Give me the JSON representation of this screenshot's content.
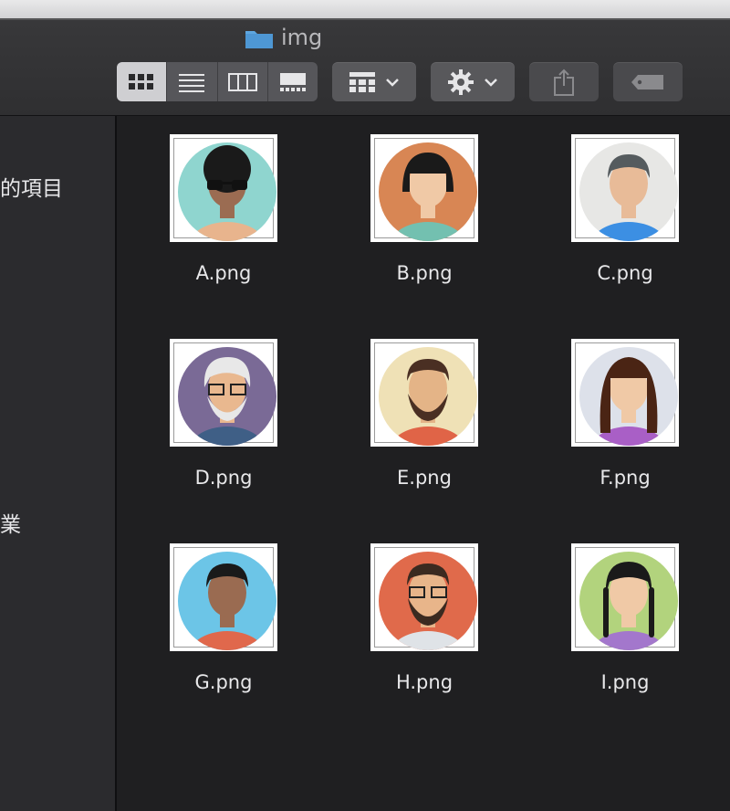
{
  "window": {
    "title": "img"
  },
  "toolbar": {
    "view_modes": [
      "icon-view",
      "list-view",
      "column-view",
      "gallery-view"
    ],
    "active_view": "icon-view",
    "group_button": "group-by",
    "action_button": "gear",
    "share_button": "share",
    "tag_button": "tag"
  },
  "sidebar": {
    "items": [
      {
        "label": "的項目"
      },
      {
        "label": "業"
      }
    ]
  },
  "files": [
    {
      "name": "A.png",
      "bg": "#8fd5cf",
      "skin": "#9b6c52",
      "hair": "#1a1a1a",
      "shirt": "#e8b48d",
      "style": "afro-glasses"
    },
    {
      "name": "B.png",
      "bg": "#d88654",
      "skin": "#f0c9a6",
      "hair": "#1a1a1a",
      "shirt": "#73c0b0",
      "style": "bob"
    },
    {
      "name": "C.png",
      "bg": "#e7e7e5",
      "skin": "#e8bb98",
      "hair": "#555b5e",
      "shirt": "#3c8fe3",
      "style": "short"
    },
    {
      "name": "D.png",
      "bg": "#7a6a96",
      "skin": "#e9b88f",
      "hair": "#e8e8e8",
      "shirt": "#3f5f86",
      "style": "old-beard"
    },
    {
      "name": "E.png",
      "bg": "#efe1b6",
      "skin": "#e4b487",
      "hair": "#4a2f23",
      "shirt": "#e06447",
      "style": "beard"
    },
    {
      "name": "F.png",
      "bg": "#dde1ea",
      "skin": "#f0c9a6",
      "hair": "#4a2414",
      "shirt": "#a95fc6",
      "style": "long"
    },
    {
      "name": "G.png",
      "bg": "#6cc5e7",
      "skin": "#9a6b51",
      "hair": "#1a1a1a",
      "shirt": "#e0684c",
      "style": "short-dark"
    },
    {
      "name": "H.png",
      "bg": "#e06a4b",
      "skin": "#e8b58a",
      "hair": "#3b2a20",
      "shirt": "#dfe3e7",
      "style": "beard-glasses"
    },
    {
      "name": "I.png",
      "bg": "#b2d37d",
      "skin": "#f0c9a6",
      "hair": "#1a1a1a",
      "shirt": "#a377cc",
      "style": "braids"
    }
  ]
}
